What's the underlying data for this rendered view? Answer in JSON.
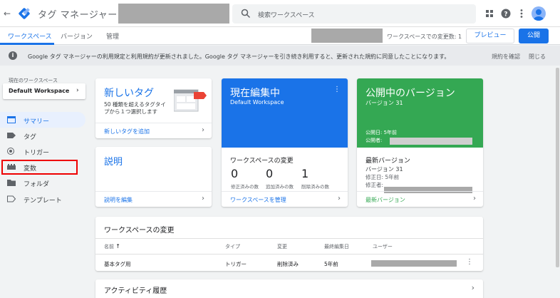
{
  "header": {
    "product_title": "タグ マネージャー",
    "search_placeholder": "検索ワークスペース"
  },
  "subnav": {
    "tabs": [
      {
        "label": "ワークスペース",
        "active": true
      },
      {
        "label": "バージョン",
        "active": false
      },
      {
        "label": "管理",
        "active": false
      }
    ],
    "workspace_changes": "ワークスペースでの変更数: 1",
    "preview_label": "プレビュー",
    "publish_label": "公開"
  },
  "notice": {
    "message": "Google タグ マネージャーの利用規定と利用規約が更新されました。Google タグ マネージャーを引き続き利用すると、更新された規約に同意したことになります。",
    "review_label": "規約を確認",
    "dismiss_label": "閉じる"
  },
  "sidebar": {
    "workspace_label": "現在のワークスペース",
    "workspace_name": "Default Workspace",
    "items": [
      {
        "label": "サマリー",
        "icon": "summary-icon",
        "active": true
      },
      {
        "label": "タグ",
        "icon": "tag-icon",
        "active": false
      },
      {
        "label": "トリガー",
        "icon": "trigger-icon",
        "active": false
      },
      {
        "label": "変数",
        "icon": "variables-icon",
        "active": false
      },
      {
        "label": "フォルダ",
        "icon": "folder-icon",
        "active": false
      },
      {
        "label": "テンプレート",
        "icon": "template-icon",
        "active": false
      }
    ]
  },
  "new_tag_card": {
    "title": "新しいタグ",
    "description": "50 種類を超えるタグタイプから１つ選択します",
    "link_label": "新しいタグを追加"
  },
  "description_card": {
    "title": "説明",
    "link_label": "説明を編集"
  },
  "editing_card": {
    "title": "現在編集中",
    "workspace": "Default Workspace",
    "changes_title": "ワークスペースの変更",
    "counters": [
      {
        "value": "0",
        "label": "修正済みの数"
      },
      {
        "value": "0",
        "label": "追加済みの数"
      },
      {
        "value": "1",
        "label": "削除済みの数"
      }
    ],
    "link_label": "ワークスペースを管理"
  },
  "published_card": {
    "title": "公開中のバージョン",
    "version": "バージョン 31",
    "published_date": "公開日: 5年前",
    "published_by_label": "公開者:",
    "latest_title": "最新バージョン",
    "latest_version": "バージョン 31",
    "modified": "修正日: 5年前",
    "modifier_label": "修正者:",
    "link_label": "最新バージョン"
  },
  "workspace_changes_table": {
    "title": "ワークスペースの変更",
    "columns": {
      "name": "名前",
      "sort_arrow": "↑",
      "type": "タイプ",
      "change": "変更",
      "last_edited": "最終編集日",
      "user": "ユーザー"
    },
    "rows": [
      {
        "name": "基本タグ用",
        "type": "トリガー",
        "change": "削除済み",
        "last_edited": "5年前"
      }
    ]
  },
  "activity": {
    "title": "アクティビティ履歴"
  },
  "colors": {
    "primary_blue": "#1a73e8",
    "published_green": "#34a853",
    "highlight_red": "#e00000"
  }
}
